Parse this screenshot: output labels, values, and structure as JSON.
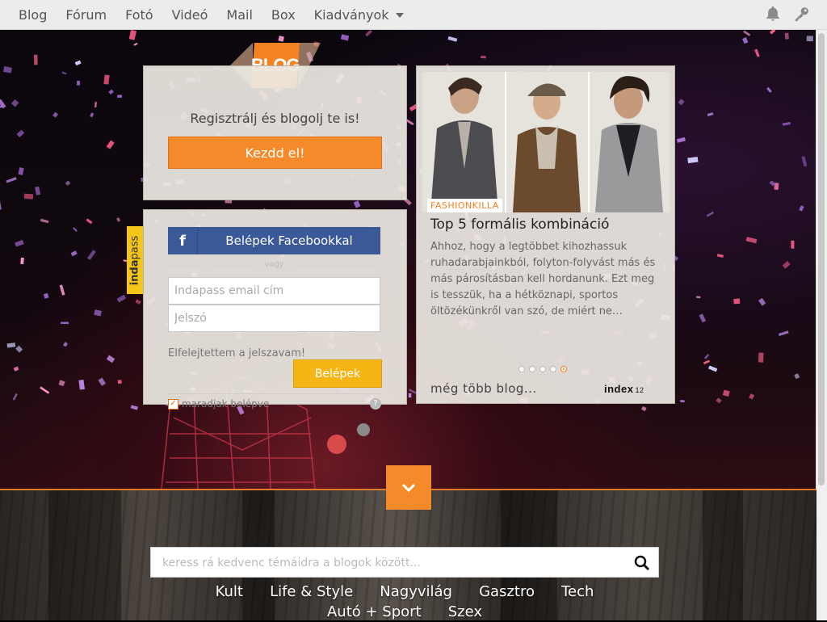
{
  "nav": {
    "items": [
      {
        "label": "Blog"
      },
      {
        "label": "Fórum"
      },
      {
        "label": "Fotó"
      },
      {
        "label": "Videó"
      },
      {
        "label": "Mail"
      },
      {
        "label": "Box"
      },
      {
        "label": "Kiadványok"
      }
    ],
    "icons": [
      "bell-icon",
      "key-icon"
    ]
  },
  "logo": {
    "text": "BLOG"
  },
  "register": {
    "prompt": "Regisztrálj és blogolj te is!",
    "button": "Kezdd el!"
  },
  "login": {
    "facebook_button": "Belépek Facebookkal",
    "separator": "vagy",
    "email_placeholder": "Indapass email cím",
    "password_placeholder": "Jelszó",
    "forgot": "Elfelejtettem a jelszavam!",
    "submit": "Belépek",
    "remember": "maradjak belépve",
    "help": "?",
    "badge_bold": "inda",
    "badge_rest": "pass"
  },
  "featured": {
    "tag": "FASHIONKILLA",
    "title": "Top 5 formális kombináció",
    "description": "Ahhoz, hogy a legtöbbet kihozhassuk ruhadarabjainkból, folyton-folyvást más és más párosításban kell hordanunk. Ezt meg is tesszük, ha a hétköznapi, sportos öltözékünkről van szó, de miért ne…",
    "dots": 5,
    "active_dot": 4,
    "more_link": "még több blog...",
    "brand": "index",
    "brand_suffix": "12"
  },
  "search": {
    "placeholder": "keress rá kedvenc témáidra a blogok között..."
  },
  "categories": [
    {
      "label": "Kult"
    },
    {
      "label": "Life & Style"
    },
    {
      "label": "Nagyvilág"
    },
    {
      "label": "Gasztro"
    },
    {
      "label": "Tech"
    },
    {
      "label": "Autó + Sport"
    },
    {
      "label": "Szex"
    }
  ],
  "colors": {
    "accent": "#f58a2b",
    "facebook": "#3b5998",
    "login_button": "#f5b514"
  }
}
